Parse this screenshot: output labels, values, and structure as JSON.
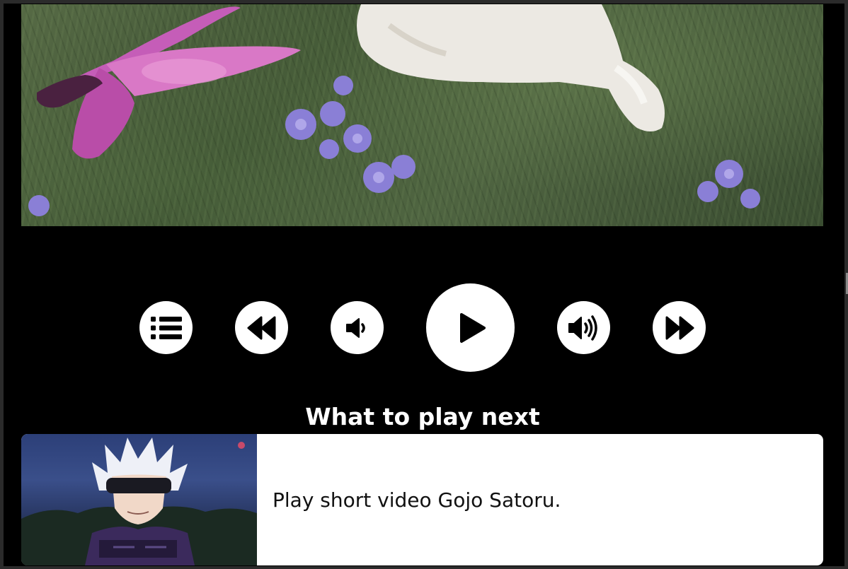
{
  "player": {
    "video_description": "anime scene: white dog and pink butterfly on grass with purple flowers",
    "controls": {
      "playlist_icon": "playlist-icon",
      "rewind_icon": "rewind-icon",
      "volume_down_icon": "volume-down-icon",
      "play_icon": "play-icon",
      "volume_up_icon": "volume-up-icon",
      "fast_forward_icon": "fast-forward-icon"
    }
  },
  "next": {
    "heading": "What to play next",
    "items": [
      {
        "label": "Play short video Gojo Satoru."
      }
    ]
  },
  "colors": {
    "background": "#000000",
    "button": "#ffffff",
    "icon": "#000000",
    "card": "#ffffff"
  }
}
